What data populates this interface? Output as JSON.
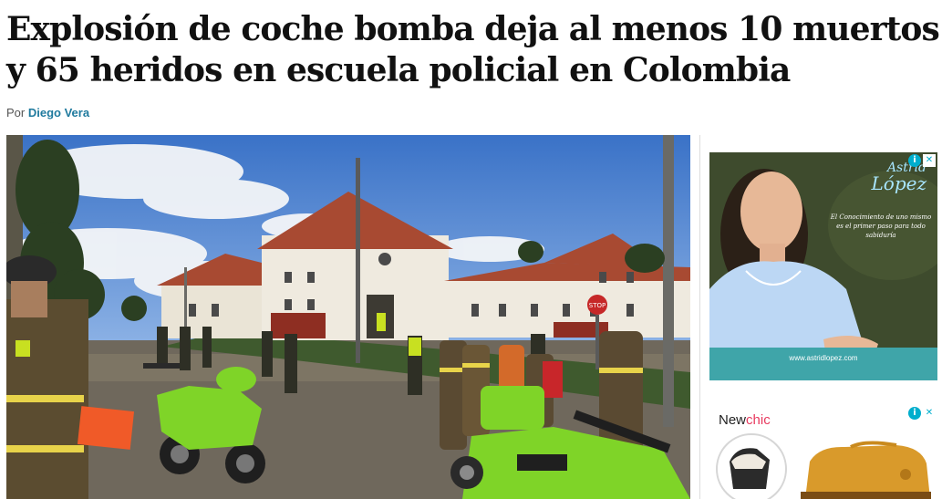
{
  "article": {
    "headline": "Explosión de coche bomba deja al menos 10 muertos y 65 heridos en escuela policial en Colombia",
    "byline_prefix": "Por",
    "author": "Diego Vera"
  },
  "photo": {
    "sign_text": "STOP"
  },
  "ads": {
    "info_icon": "i",
    "close_icon": "✕",
    "ad1": {
      "brand_line1": "Astrid",
      "brand_line2": "López",
      "tagline": "El Conocimiento de uno mismo es el primer paso para todo sabiduría",
      "url": "www.astridlopez.com"
    },
    "ad2": {
      "brand_part1": "New",
      "brand_part2": "chic"
    }
  },
  "colors": {
    "author_link": "#1f7a9e",
    "ad_choices": "#00aecd",
    "newchic_accent": "#e83a5f"
  }
}
